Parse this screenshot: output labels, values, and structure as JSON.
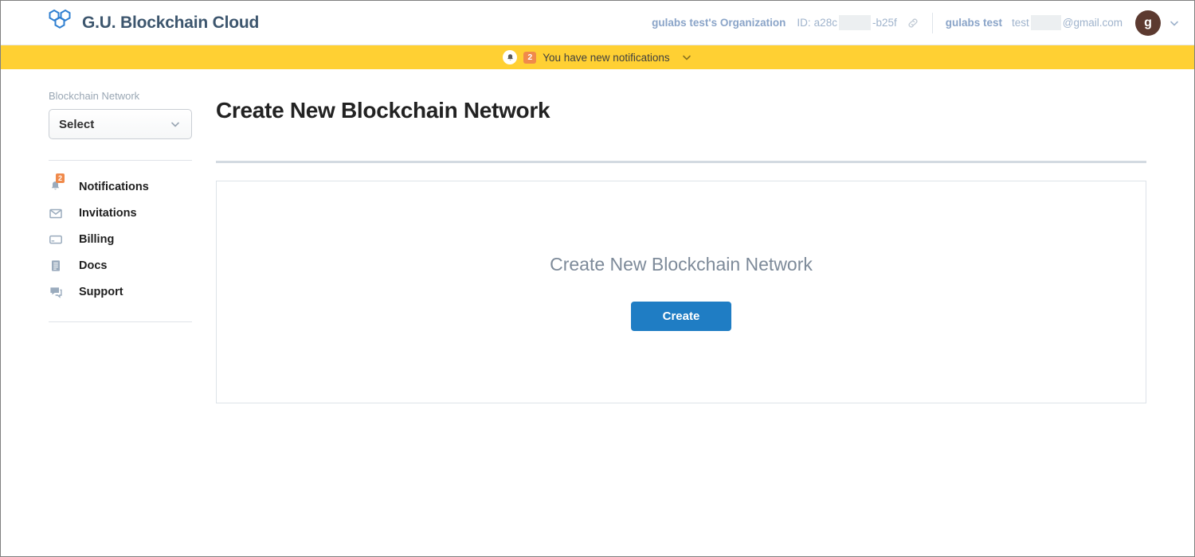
{
  "header": {
    "brand_title": "G.U. Blockchain Cloud",
    "logo_icon": "hexagon-cluster-logo",
    "org_name": "gulabs test's Organization",
    "org_id_label": "ID:",
    "org_id_prefix": "a28c",
    "org_id_suffix": "-b25f",
    "link_icon": "link-icon",
    "user_name": "gulabs test",
    "user_email_prefix": "test",
    "user_email_suffix": "@gmail.com",
    "avatar_initial": "g",
    "account_caret_icon": "chevron-down-icon"
  },
  "notification_bar": {
    "bell_icon": "bell-icon",
    "count": "2",
    "text": "You have new notifications",
    "expand_icon": "chevron-down-icon"
  },
  "sidebar": {
    "section_label": "Blockchain Network",
    "select": {
      "value": "Select",
      "caret_icon": "chevron-down-icon"
    },
    "items": [
      {
        "label": "Notifications",
        "icon": "bell-icon",
        "badge": "2"
      },
      {
        "label": "Invitations",
        "icon": "envelope-icon",
        "badge": ""
      },
      {
        "label": "Billing",
        "icon": "credit-card-icon",
        "badge": ""
      },
      {
        "label": "Docs",
        "icon": "document-icon",
        "badge": ""
      },
      {
        "label": "Support",
        "icon": "chat-bubbles-icon",
        "badge": ""
      }
    ]
  },
  "main": {
    "page_title": "Create New Blockchain Network",
    "card": {
      "message": "Create New Blockchain Network",
      "button_label": "Create"
    }
  },
  "colors": {
    "brand_text": "#3d566e",
    "banner_yellow": "#ffd033",
    "badge_orange": "#f08a4b",
    "primary_blue": "#1f7dc4",
    "avatar_brown": "#5c3a30",
    "muted_blue_gray": "#9fb3cc"
  }
}
